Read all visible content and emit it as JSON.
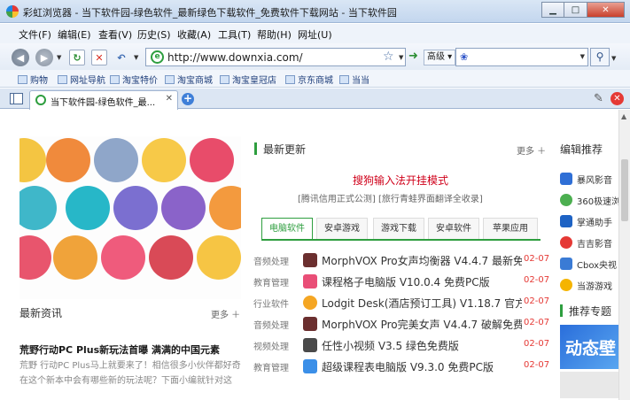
{
  "window": {
    "title": "彩虹浏览器 - 当下软件园-绿色软件_最新绿色下载软件_免费软件下载网站 - 当下软件园",
    "min": "▁",
    "max": "□",
    "close": "✕"
  },
  "menu": [
    "文件(F)",
    "编辑(E)",
    "查看(V)",
    "历史(S)",
    "收藏(A)",
    "工具(T)",
    "帮助(H)",
    "网址(U)"
  ],
  "nav": {
    "back": "◀",
    "forward": "▶",
    "refresh": "↻",
    "stop": "✕",
    "undo": "↶",
    "address": "http://www.downxia.com/",
    "advanced": "高级",
    "search_placeholder": ""
  },
  "favorites": [
    "购物",
    "网址导航",
    "淘宝特价",
    "淘宝商城",
    "淘宝皇冠店",
    "京东商城",
    "当当"
  ],
  "tab": {
    "label": "当下软件园-绿色软件_最...",
    "close": "✕",
    "new": "+"
  },
  "page": {
    "latest_news": {
      "title": "最新资讯",
      "more": "更多 ＋"
    },
    "news_item": {
      "headline": "荒野行动PC Plus新玩法首曝 满满的中国元素",
      "summary": "荒野 行动PC Plus马上就要来了！相信很多小伙伴都好奇在这个新本中会有哪些新的玩法呢？下面小编就针对这"
    },
    "latest_updates": {
      "title": "最新更新",
      "more": "更多 ＋"
    },
    "promo": {
      "headline": "搜狗输入法开挂模式",
      "sub": "[腾讯信用正式公测]  [旅行青蛙界面翻译全收录]"
    },
    "tabs": [
      "电脑软件",
      "安卓游戏",
      "游戏下载",
      "安卓软件",
      "苹果应用"
    ],
    "rows": [
      {
        "cat": "音频处理",
        "title": "MorphVOX Pro女声均衡器 V4.4.7 最新免",
        "date": "02-07",
        "color": "#6b2f2f"
      },
      {
        "cat": "教育管理",
        "title": "课程格子电脑版 V10.0.4 免费PC版",
        "date": "02-07",
        "color": "#e94e77"
      },
      {
        "cat": "行业软件",
        "title": "Lodgit Desk(酒店预订工具) V1.18.7 官方",
        "date": "02-07",
        "color": "#f5a623"
      },
      {
        "cat": "音频处理",
        "title": "MorphVOX Pro完美女声 V4.4.7 破解免费",
        "date": "02-07",
        "color": "#6b2f2f"
      },
      {
        "cat": "视频处理",
        "title": "任性小视频 V3.5 绿色免费版",
        "date": "02-07",
        "color": "#4a4a4a"
      },
      {
        "cat": "教育管理",
        "title": "超级课程表电脑版 V9.3.0 免费PC版",
        "date": "02-07",
        "color": "#3b8fe8"
      }
    ],
    "editor_picks": {
      "title": "编辑推荐",
      "items": [
        {
          "label": "暴风影音",
          "color": "#2f6fd6"
        },
        {
          "label": "360极速浏",
          "color": "#4caf50"
        },
        {
          "label": "掌通助手",
          "color": "#1e63c4"
        },
        {
          "label": "吉吉影音",
          "color": "#e53935"
        },
        {
          "label": "Cbox央视",
          "color": "#3a7bd5"
        },
        {
          "label": "当游游戏",
          "color": "#f5b400"
        }
      ]
    },
    "topics": {
      "title": "推荐专题",
      "banner_text": "动态壁"
    }
  },
  "colors": {
    "accent": "#2e9e3f",
    "date_red": "#e53935",
    "promo_red": "#d0021b"
  }
}
